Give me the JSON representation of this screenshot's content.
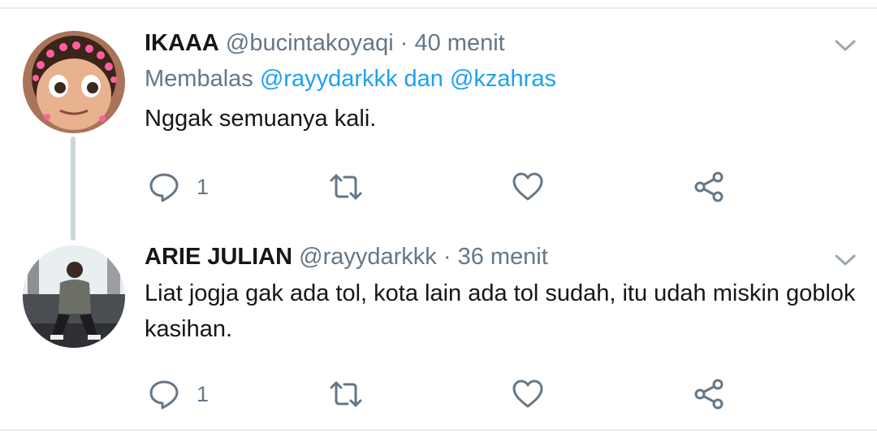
{
  "tweets": [
    {
      "name": "IKAAA",
      "handle": "@bucintakoyaqi",
      "separator": "·",
      "time": "40 menit",
      "reply_prefix": "Membalas",
      "reply_mentions": "@rayydarkkk dan @kzahras",
      "text": "Nggak semuanya kali.",
      "reply_count": "1"
    },
    {
      "name": "ARIE JULIAN",
      "handle": "@rayydarkkk",
      "separator": "·",
      "time": "36 menit",
      "text": "Liat jogja gak ada tol, kota lain ada tol sudah, itu udah miskin goblok kasihan.",
      "reply_count": "1"
    }
  ],
  "icons": [
    "reply-icon",
    "retweet-icon",
    "like-icon",
    "share-icon",
    "chevron-down-icon"
  ],
  "colors": {
    "link": "#1da1f2",
    "muted": "#657786",
    "text": "#14171a",
    "thread_line": "#ccd6dd"
  }
}
